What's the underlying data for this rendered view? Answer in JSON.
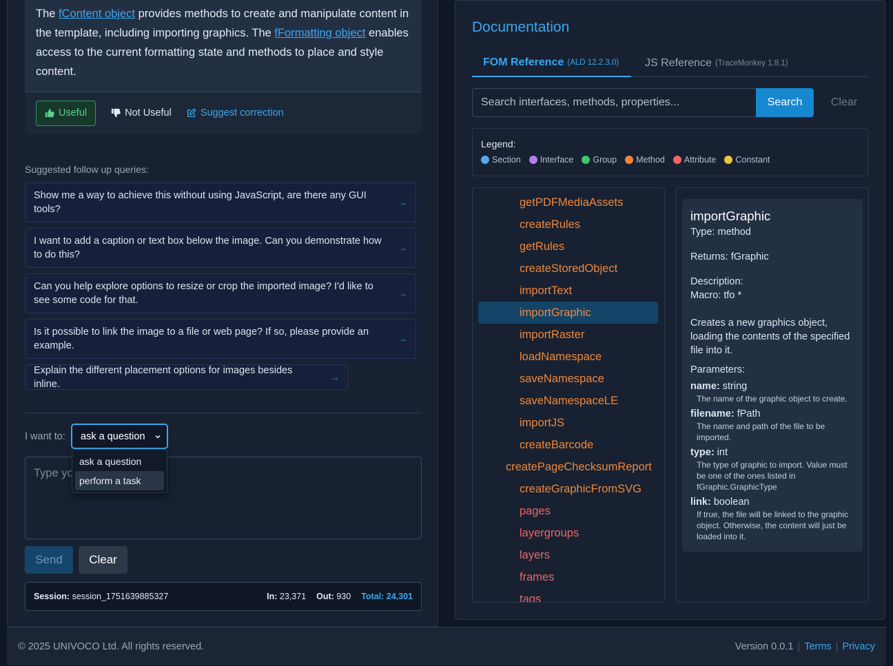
{
  "answer": {
    "t1": "The ",
    "link1": "fContent object",
    "t2": " provides methods to create and manipulate content in the template, including importing graphics. The ",
    "link2": "fFormatting object",
    "t3": " enables access to the current formatting state and methods to place and style content."
  },
  "feedback": {
    "useful": "Useful",
    "not_useful": "Not Useful",
    "suggest": "Suggest correction"
  },
  "followups": {
    "label": "Suggested follow up queries:",
    "items": [
      "Show me a way to achieve this without using JavaScript, are there any GUI tools?",
      "I want to add a caption or text box below the image. Can you demonstrate how to do this?",
      "Can you help explore options to resize or crop the imported image? I'd like to see some code for that.",
      "Is it possible to link the image to a file or web page? If so, please provide an example.",
      "Explain the different placement options for images besides inline."
    ],
    "arrow": "→"
  },
  "composer": {
    "label": "I want to:",
    "selected": "ask a question",
    "options": [
      "ask a question",
      "perform a task"
    ],
    "placeholder": "Type yo",
    "send": "Send",
    "clear": "Clear"
  },
  "session": {
    "label": "Session:",
    "id": "session_1751639885327",
    "in_label": "In:",
    "in": "23,371",
    "out_label": "Out:",
    "out": "930",
    "total_label": "Total:",
    "total": "24,301"
  },
  "docs": {
    "title": "Documentation",
    "tabs": [
      {
        "label": "FOM Reference",
        "sub": "(ALD 12.2.3.0)"
      },
      {
        "label": "JS Reference",
        "sub": "(TraceMonkey 1.8.1)"
      }
    ],
    "search_placeholder": "Search interfaces, methods, properties...",
    "search_button": "Search",
    "clear_button": "Clear",
    "legend": {
      "title": "Legend:",
      "items": [
        {
          "label": "Section",
          "color": "#58a6f0"
        },
        {
          "label": "Interface",
          "color": "#b07ef0"
        },
        {
          "label": "Group",
          "color": "#3fc46a"
        },
        {
          "label": "Method",
          "color": "#f0873a"
        },
        {
          "label": "Attribute",
          "color": "#f06464"
        },
        {
          "label": "Constant",
          "color": "#f0c43a"
        }
      ]
    },
    "tree": [
      {
        "label": "getPDFMediaAssets",
        "kind": "method",
        "color": "#f0873a"
      },
      {
        "label": "createRules",
        "kind": "method",
        "color": "#f0873a"
      },
      {
        "label": "getRules",
        "kind": "method",
        "color": "#f0873a"
      },
      {
        "label": "createStoredObject",
        "kind": "method",
        "color": "#f0873a"
      },
      {
        "label": "importText",
        "kind": "method",
        "color": "#f0873a"
      },
      {
        "label": "importGraphic",
        "kind": "method",
        "color": "#f0873a",
        "selected": true
      },
      {
        "label": "importRaster",
        "kind": "method",
        "color": "#f0873a"
      },
      {
        "label": "loadNamespace",
        "kind": "method",
        "color": "#f0873a"
      },
      {
        "label": "saveNamespace",
        "kind": "method",
        "color": "#f0873a"
      },
      {
        "label": "saveNamespaceLE",
        "kind": "method",
        "color": "#f0873a"
      },
      {
        "label": "importJS",
        "kind": "method",
        "color": "#f0873a"
      },
      {
        "label": "createBarcode",
        "kind": "method",
        "color": "#f0873a"
      },
      {
        "label": "createPageChecksumReport",
        "kind": "method",
        "color": "#f0873a"
      },
      {
        "label": "createGraphicFromSVG",
        "kind": "method",
        "color": "#f0873a"
      },
      {
        "label": "pages",
        "kind": "attribute",
        "color": "#f06464"
      },
      {
        "label": "layergroups",
        "kind": "attribute",
        "color": "#f06464"
      },
      {
        "label": "layers",
        "kind": "attribute",
        "color": "#f06464"
      },
      {
        "label": "frames",
        "kind": "attribute",
        "color": "#f06464"
      },
      {
        "label": "tags",
        "kind": "attribute",
        "color": "#f06464"
      }
    ],
    "detail": {
      "name": "importGraphic",
      "type": "Type: method",
      "returns": "Returns: fGraphic",
      "description_label": "Description:",
      "macro": "Macro: tfo *",
      "description": "Creates a new graphics object, loading the contents of the specified file into it.",
      "parameters_label": "Parameters:",
      "parameters": [
        {
          "name": "name:",
          "type": " string",
          "desc": "The name of the graphic object to create."
        },
        {
          "name": "filename:",
          "type": " fPath",
          "desc": "The name and path of the file to be imported."
        },
        {
          "name": "type:",
          "type": " int",
          "desc": "The type of graphic to import. Value must be one of the ones listed in fGraphic.GraphicType"
        },
        {
          "name": "link:",
          "type": " boolean",
          "desc": "If true, the file will be linked to the graphic object. Otherwise, the content will just be loaded into it."
        }
      ]
    }
  },
  "footer": {
    "copyright": "© 2025 UNIVOCO Ltd. All rights reserved.",
    "version": "Version 0.0.1",
    "sep": "|",
    "terms": "Terms",
    "privacy": "Privacy"
  }
}
